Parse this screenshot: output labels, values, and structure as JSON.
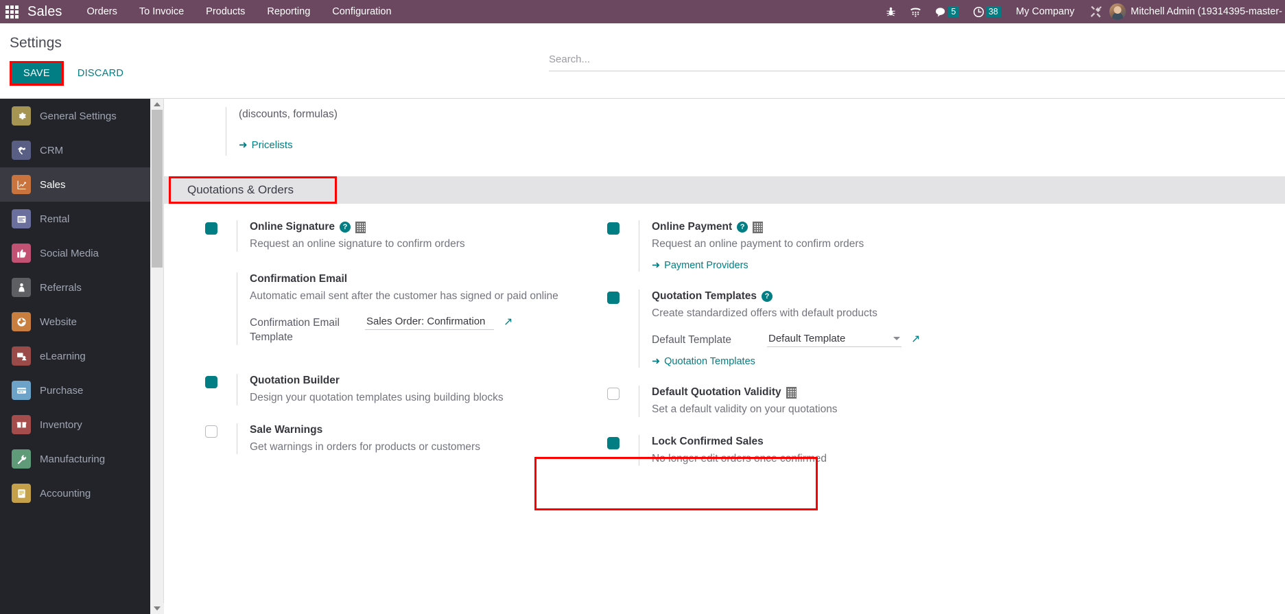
{
  "navbar": {
    "apps_icon": "apps-grid-icon",
    "brand": "Sales",
    "menu": [
      "Orders",
      "To Invoice",
      "Products",
      "Reporting",
      "Configuration"
    ],
    "icons": [
      {
        "name": "bug-icon",
        "glyph": "🐞"
      },
      {
        "name": "phone-dialpad-icon",
        "glyph": "☎"
      }
    ],
    "messages": {
      "icon": "chat-bubble-icon",
      "count": "5"
    },
    "activities": {
      "icon": "clock-icon",
      "count": "38"
    },
    "company": "My Company",
    "tools_icon": "tools-icon",
    "user": "Mitchell Admin (19314395-master-"
  },
  "control_panel": {
    "title": "Settings",
    "save_label": "SAVE",
    "discard_label": "DISCARD",
    "search_placeholder": "Search..."
  },
  "sidebar": {
    "items": [
      {
        "label": "General Settings",
        "icon": "gear-icon",
        "color": "#a59452",
        "active": false
      },
      {
        "label": "CRM",
        "icon": "handshake-icon",
        "color": "#595e85",
        "active": false
      },
      {
        "label": "Sales",
        "icon": "chart-line-icon",
        "color": "#c9733f",
        "active": true
      },
      {
        "label": "Rental",
        "icon": "calendar-icon",
        "color": "#6b6f9e",
        "active": false
      },
      {
        "label": "Social Media",
        "icon": "thumbs-up-icon",
        "color": "#c25273",
        "active": false
      },
      {
        "label": "Referrals",
        "icon": "person-gift-icon",
        "color": "#5d5f63",
        "active": false
      },
      {
        "label": "Website",
        "icon": "globe-icon",
        "color": "#c87e3e",
        "active": false
      },
      {
        "label": "eLearning",
        "icon": "presentation-icon",
        "color": "#9a4a48",
        "active": false
      },
      {
        "label": "Purchase",
        "icon": "credit-card-icon",
        "color": "#6ea3c9",
        "active": false
      },
      {
        "label": "Inventory",
        "icon": "box-icon",
        "color": "#a54c4c",
        "active": false
      },
      {
        "label": "Manufacturing",
        "icon": "wrench-icon",
        "color": "#5f9b78",
        "active": false
      },
      {
        "label": "Accounting",
        "icon": "book-icon",
        "color": "#c4a04a",
        "active": false
      }
    ]
  },
  "content": {
    "pricing_fragment": {
      "description": "(discounts, formulas)",
      "link": "Pricelists"
    },
    "section": {
      "title": "Quotations & Orders",
      "highlighted": true
    },
    "left_column": [
      {
        "id": "online-signature",
        "checkbox": "on",
        "title": "Online Signature",
        "has_help": true,
        "has_company_icon": true,
        "description": "Request an online signature to confirm orders"
      },
      {
        "id": "confirmation-email",
        "checkbox": "hidden",
        "title": "Confirmation Email",
        "has_help": false,
        "has_company_icon": false,
        "description": "Automatic email sent after the customer has signed or paid online",
        "field": {
          "label": "Confirmation Email Template",
          "value": "Sales Order: Confirmation",
          "type": "input",
          "external_link": true
        }
      },
      {
        "id": "quotation-builder",
        "checkbox": "on",
        "title": "Quotation Builder",
        "has_help": false,
        "has_company_icon": false,
        "description": "Design your quotation templates using building blocks"
      },
      {
        "id": "sale-warnings",
        "checkbox": "off",
        "title": "Sale Warnings",
        "has_help": false,
        "has_company_icon": false,
        "description": "Get warnings in orders for products or customers"
      }
    ],
    "right_column": [
      {
        "id": "online-payment",
        "checkbox": "on",
        "title": "Online Payment",
        "has_help": true,
        "has_company_icon": true,
        "description": "Request an online payment to confirm orders",
        "sub_link": "Payment Providers"
      },
      {
        "id": "quotation-templates",
        "checkbox": "on",
        "title": "Quotation Templates",
        "has_help": true,
        "has_company_icon": false,
        "description": "Create standardized offers with default products",
        "field": {
          "label": "Default Template",
          "value": "Default Template",
          "type": "select",
          "external_link": true
        },
        "sub_link": "Quotation Templates"
      },
      {
        "id": "default-quotation-validity",
        "checkbox": "off",
        "title": "Default Quotation Validity",
        "has_help": false,
        "has_company_icon": true,
        "description": "Set a default validity on your quotations"
      },
      {
        "id": "lock-confirmed-sales",
        "checkbox": "on",
        "title": "Lock Confirmed Sales",
        "has_help": false,
        "has_company_icon": false,
        "description": "No longer edit orders once confirmed",
        "highlighted": true
      }
    ]
  },
  "colors": {
    "navbar_bg": "#6b485f",
    "accent_teal": "#017e84",
    "annotation_red": "#ff0000",
    "sidebar_bg": "#23242a",
    "section_bg": "#e3e3e6"
  }
}
